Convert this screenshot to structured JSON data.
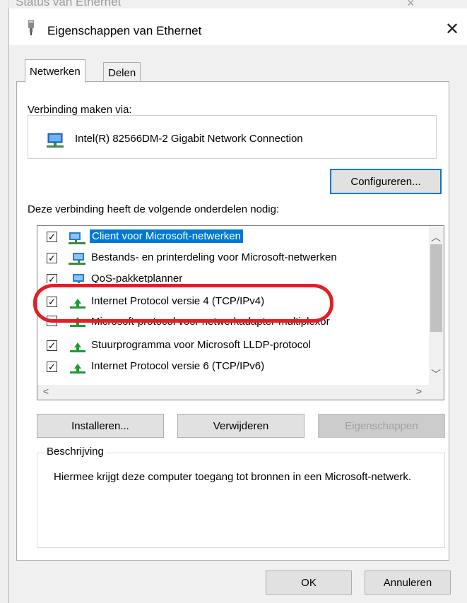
{
  "background_window": {
    "title": "Status van Ethernet"
  },
  "dialog": {
    "title": "Eigenschappen van Ethernet",
    "tabs": [
      {
        "label": "Netwerken",
        "active": true
      },
      {
        "label": "Delen",
        "active": false
      }
    ],
    "connect_via_label": "Verbinding maken via:",
    "adapter_name": "Intel(R) 82566DM-2 Gigabit Network Connection",
    "configure_button": "Configureren...",
    "components_label": "Deze verbinding heeft de volgende onderdelen nodig:",
    "components": [
      {
        "label": "Client voor Microsoft-netwerken",
        "checked": true,
        "selected": true,
        "icon": "network-client-icon"
      },
      {
        "label": "Bestands- en printerdeling voor Microsoft-netwerken",
        "checked": true,
        "selected": false,
        "icon": "network-service-icon"
      },
      {
        "label": "QoS-pakketplanner",
        "checked": true,
        "selected": false,
        "icon": "network-service-icon"
      },
      {
        "label": "Internet Protocol versie 4 (TCP/IPv4)",
        "checked": true,
        "selected": false,
        "icon": "protocol-icon"
      },
      {
        "label": "Microsoft-protocol voor netwerkadapter-multiplexor",
        "checked": false,
        "selected": false,
        "icon": "protocol-icon"
      },
      {
        "label": "Stuurprogramma voor Microsoft LLDP-protocol",
        "checked": true,
        "selected": false,
        "icon": "protocol-icon"
      },
      {
        "label": "Internet Protocol versie 6 (TCP/IPv6)",
        "checked": true,
        "selected": false,
        "icon": "protocol-icon"
      }
    ],
    "install_button": "Installeren...",
    "remove_button": "Verwijderen",
    "properties_button": "Eigenschappen",
    "description_legend": "Beschrijving",
    "description_text": "Hiermee krijgt deze computer toegang tot bronnen in een Microsoft-netwerk.",
    "ok_button": "OK",
    "cancel_button": "Annuleren"
  },
  "colors": {
    "selection": "#0078d7",
    "annotation": "#e31e24",
    "icon_green": "#1e9a32"
  }
}
